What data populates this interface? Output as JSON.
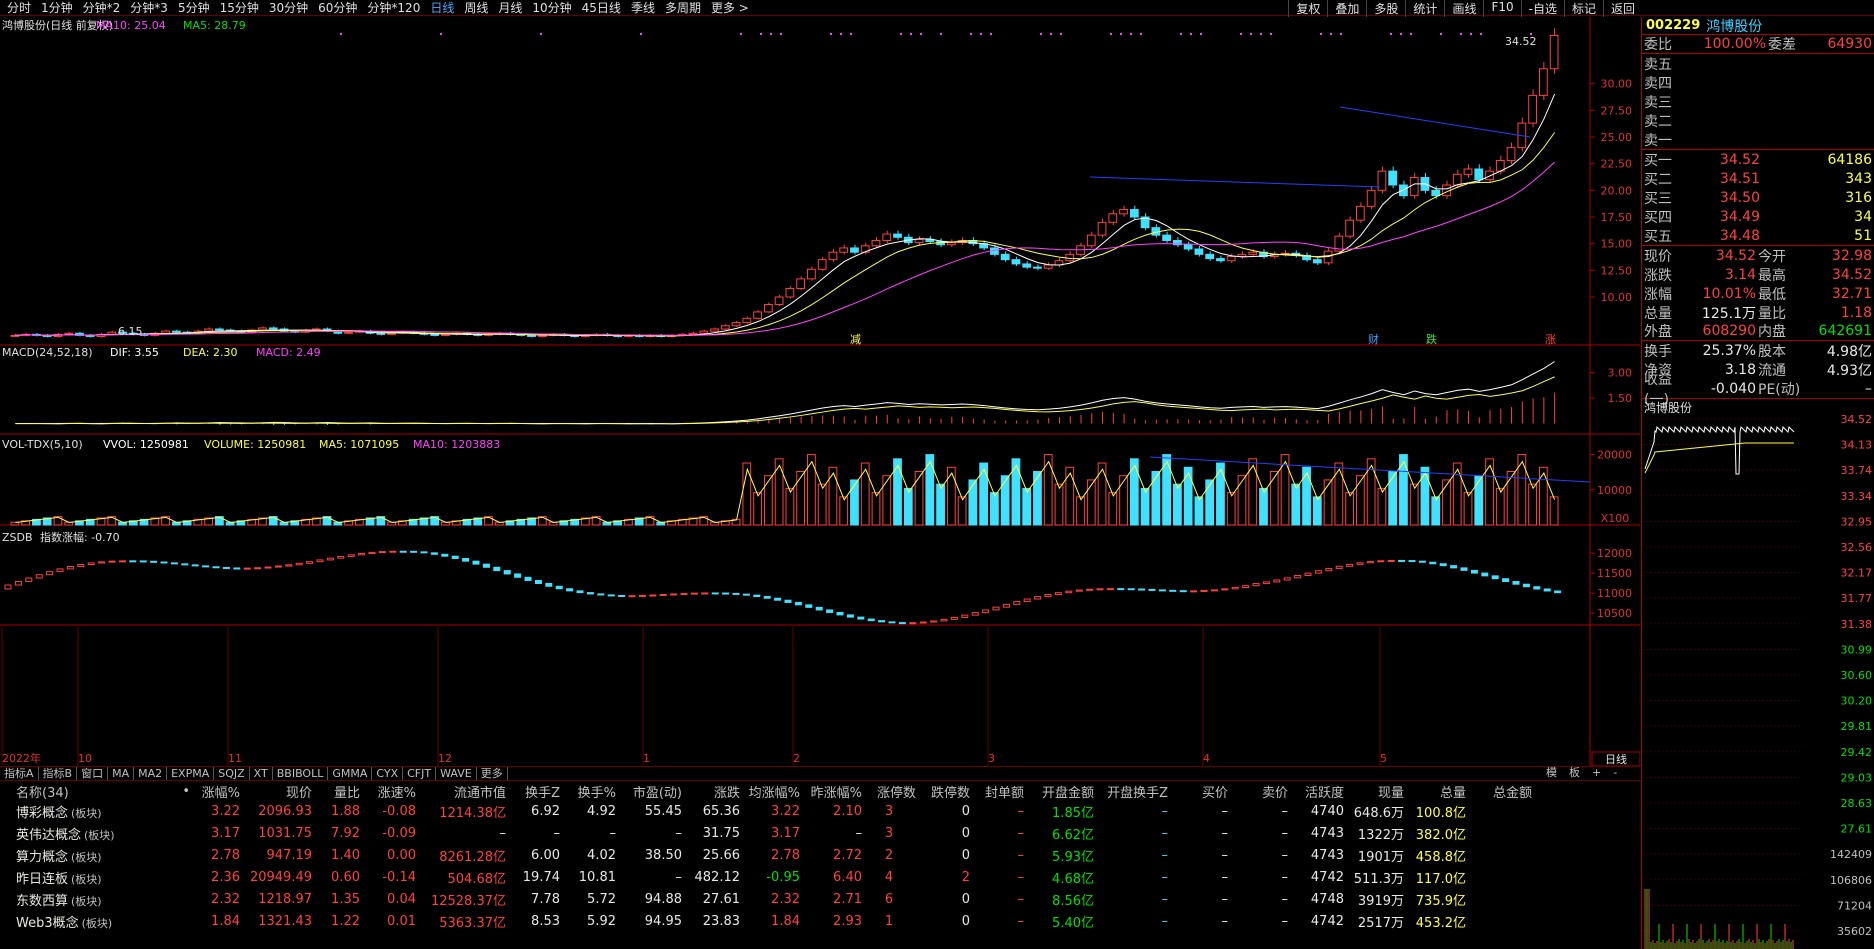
{
  "toolbar": {
    "periods": [
      "分时",
      "1分钟",
      "分钟*2",
      "分钟*3",
      "5分钟",
      "15分钟",
      "30分钟",
      "60分钟",
      "分钟*120",
      "日线",
      "周线",
      "月线",
      "10分钟",
      "45日线",
      "季线",
      "多周期",
      "更多 >"
    ],
    "active": "日线",
    "tools": [
      "复权",
      "叠加",
      "多股",
      "统计",
      "画线",
      "F10",
      "-自选",
      "标记",
      "返回"
    ]
  },
  "chart_header": {
    "title": "鸿博股份(日线 前复权)",
    "ma10": "MA10: 25.04",
    "ma5": "MA5: 28.79"
  },
  "price_panel": {
    "y_ticks": [
      "30.00",
      "27.50",
      "25.00",
      "22.50",
      "20.00",
      "17.50",
      "15.00",
      "12.50",
      "10.00"
    ],
    "high_label": "34.52",
    "low_label": "6.15",
    "markers": [
      "减",
      "财",
      "跌",
      "涨"
    ]
  },
  "macd_panel": {
    "label": "MACD(24,52,18)",
    "dif": "DIF: 3.55",
    "dea": "DEA: 2.30",
    "macd": "MACD: 2.49",
    "y_ticks": [
      "3.00",
      "1.50"
    ]
  },
  "vol_panel": {
    "label": "VOL-TDX(5,10)",
    "vvol": "VVOL: 1250981",
    "volume": "VOLUME: 1250981",
    "ma5": "MA5: 1071095",
    "ma10": "MA10: 1203883",
    "y_ticks": [
      "20000",
      "10000"
    ],
    "unit": "X100"
  },
  "zsdb_panel": {
    "label": "ZSDB",
    "index_chg": "指数涨幅: -0.70",
    "y_ticks": [
      "12000",
      "11500",
      "11000",
      "10500"
    ]
  },
  "date_axis": [
    "2022年",
    "10",
    "11",
    "12",
    "1",
    "2",
    "3",
    "4",
    "5"
  ],
  "sub_tabs": [
    "指标A",
    "指标B",
    "窗口",
    "MA",
    "MA2",
    "EXPMA",
    "SQJZ",
    "XT",
    "BBIBOLL",
    "GMMA",
    "CYX",
    "CFJT",
    "WAVE",
    "更多"
  ],
  "sub_right": [
    "模",
    "板",
    "+",
    "-"
  ],
  "table": {
    "headers": [
      "名称(34)",
      "•",
      "涨幅%",
      "现价",
      "量比",
      "涨速%",
      "流通市值",
      "换手Z",
      "换手%",
      "市盈(动)",
      "涨跌",
      "均涨幅%",
      "昨涨幅%",
      "涨停数",
      "跌停数",
      "封单额",
      "开盘金额",
      "开盘换手Z",
      "买价",
      "卖价",
      "活跃度",
      "现量",
      "总量",
      "总金额"
    ],
    "rows": [
      [
        "博彩概念",
        "(板块)",
        "",
        "3.22",
        "2096.93",
        "1.88",
        "-0.08",
        "1214.38亿",
        "6.92",
        "4.92",
        "55.45",
        "65.36",
        "3.22",
        "2.10",
        "3",
        "0",
        "–",
        "1.85亿",
        "–",
        "–",
        "–",
        "4740",
        "648.6万",
        "100.8亿"
      ],
      [
        "英伟达概念",
        "(板块)",
        "",
        "3.17",
        "1031.75",
        "7.92",
        "-0.09",
        "–",
        "–",
        "–",
        "–",
        "31.75",
        "3.17",
        "–",
        "3",
        "0",
        "–",
        "6.62亿",
        "–",
        "–",
        "–",
        "4743",
        "1322万",
        "382.0亿"
      ],
      [
        "算力概念",
        "(板块)",
        "",
        "2.78",
        "947.19",
        "1.40",
        "0.00",
        "8261.28亿",
        "6.00",
        "4.02",
        "38.50",
        "25.66",
        "2.78",
        "2.72",
        "2",
        "0",
        "–",
        "5.93亿",
        "–",
        "–",
        "–",
        "4743",
        "1901万",
        "458.8亿"
      ],
      [
        "昨日连板",
        "(板块)",
        "",
        "2.36",
        "20949.49",
        "0.60",
        "-0.14",
        "504.68亿",
        "19.74",
        "10.81",
        "–",
        "482.12",
        "-0.95",
        "6.40",
        "4",
        "2",
        "–",
        "4.68亿",
        "–",
        "–",
        "–",
        "4742",
        "511.3万",
        "117.0亿"
      ],
      [
        "东数西算",
        "(板块)",
        "",
        "2.32",
        "1218.97",
        "1.35",
        "0.04",
        "12528.37亿",
        "7.78",
        "5.72",
        "94.88",
        "27.61",
        "2.32",
        "2.71",
        "6",
        "0",
        "–",
        "8.56亿",
        "–",
        "–",
        "–",
        "4748",
        "3919万",
        "735.9亿"
      ],
      [
        "Web3概念",
        "(板块)",
        "",
        "1.84",
        "1321.43",
        "1.22",
        "0.01",
        "5363.37亿",
        "8.53",
        "5.92",
        "94.95",
        "23.83",
        "1.84",
        "2.93",
        "1",
        "0",
        "–",
        "5.40亿",
        "–",
        "–",
        "–",
        "4742",
        "2517万",
        "453.2亿"
      ]
    ]
  },
  "right": {
    "code": "002229",
    "name": "鸿博股份",
    "weibi_l": "委比",
    "weibi": "100.00%",
    "weicha_l": "委差",
    "weicha": "64930",
    "asks": [
      {
        "l": "卖五",
        "p": "",
        "v": ""
      },
      {
        "l": "卖四",
        "p": "",
        "v": ""
      },
      {
        "l": "卖三",
        "p": "",
        "v": ""
      },
      {
        "l": "卖二",
        "p": "",
        "v": ""
      },
      {
        "l": "卖一",
        "p": "",
        "v": ""
      }
    ],
    "bids": [
      {
        "l": "买一",
        "p": "34.52",
        "v": "64186"
      },
      {
        "l": "买二",
        "p": "34.51",
        "v": "343"
      },
      {
        "l": "买三",
        "p": "34.50",
        "v": "316"
      },
      {
        "l": "买四",
        "p": "34.49",
        "v": "34"
      },
      {
        "l": "买五",
        "p": "34.48",
        "v": "51"
      }
    ],
    "quote": [
      [
        "现价",
        "34.52",
        "今开",
        "32.98"
      ],
      [
        "涨跌",
        "3.14",
        "最高",
        "34.52"
      ],
      [
        "涨幅",
        "10.01%",
        "最低",
        "32.71"
      ],
      [
        "总量",
        "125.1万",
        "量比",
        "1.18"
      ],
      [
        "外盘",
        "608290",
        "内盘",
        "642691"
      ],
      [
        "换手",
        "25.37%",
        "股本",
        "4.98亿"
      ],
      [
        "净资",
        "3.18",
        "流通",
        "4.93亿"
      ],
      [
        "收益(一)",
        "-0.040",
        "PE(动)",
        "–"
      ]
    ],
    "mini_title": "鸿博股份",
    "mini_ticks": [
      "34.52",
      "34.13",
      "33.74",
      "33.34",
      "32.95",
      "32.56",
      "32.17",
      "31.77",
      "31.38",
      "30.99",
      "30.60",
      "30.20",
      "29.81",
      "29.42",
      "29.03",
      "28.63",
      "27.61",
      "142409",
      "106806",
      "71204",
      "35602"
    ]
  },
  "chart_data": {
    "type": "candlestick",
    "series": [
      {
        "name": "MA5",
        "color": "#ffffff"
      },
      {
        "name": "MA10",
        "color": "#ffff00"
      },
      {
        "name": "MA20",
        "color": "#ff40ff"
      }
    ],
    "closes": [
      6.4,
      6.5,
      6.4,
      6.3,
      6.5,
      6.6,
      6.4,
      6.3,
      6.5,
      6.7,
      6.6,
      6.5,
      6.4,
      6.6,
      6.8,
      6.7,
      6.6,
      6.8,
      7.0,
      6.9,
      6.8,
      6.7,
      6.9,
      7.1,
      7.0,
      6.8,
      6.7,
      6.9,
      7.0,
      6.8,
      6.6,
      6.7,
      6.8,
      6.6,
      6.5,
      6.6,
      6.7,
      6.6,
      6.5,
      6.4,
      6.5,
      6.6,
      6.5,
      6.4,
      6.5,
      6.6,
      6.5,
      6.4,
      6.3,
      6.4,
      6.5,
      6.4,
      6.3,
      6.4,
      6.5,
      6.4,
      6.3,
      6.4,
      6.3,
      6.4,
      6.3,
      6.4,
      6.5,
      6.6,
      6.8,
      7.0,
      7.3,
      7.6,
      8.0,
      8.6,
      9.3,
      10.0,
      10.8,
      11.7,
      12.6,
      13.5,
      14.2,
      14.6,
      14.2,
      14.8,
      15.3,
      15.9,
      15.6,
      15.1,
      15.4,
      15.2,
      14.9,
      15.1,
      15.3,
      15.0,
      14.6,
      14.0,
      13.5,
      13.1,
      12.8,
      12.7,
      13.0,
      13.4,
      14.0,
      14.8,
      15.8,
      17.0,
      17.8,
      18.2,
      17.5,
      16.5,
      15.8,
      15.3,
      14.9,
      14.5,
      14.0,
      13.6,
      13.4,
      13.8,
      14.0,
      14.2,
      13.8,
      14.0,
      14.1,
      13.9,
      13.5,
      13.2,
      14.3,
      15.7,
      17.2,
      18.5,
      20.0,
      21.8,
      20.5,
      19.5,
      21.2,
      20.0,
      19.5,
      20.5,
      21.5,
      22.0,
      21.0,
      21.8,
      22.8,
      24.0,
      26.3,
      28.9,
      31.4,
      34.52
    ]
  }
}
